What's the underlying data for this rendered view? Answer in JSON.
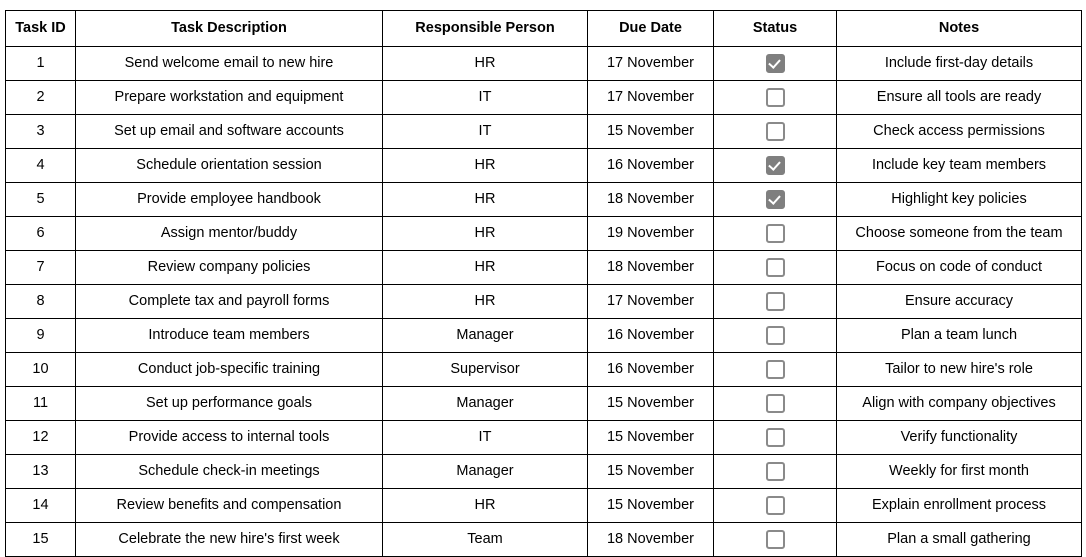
{
  "table": {
    "columns": [
      {
        "key": "task_id",
        "label": "Task ID"
      },
      {
        "key": "task_desc",
        "label": "Task Description"
      },
      {
        "key": "person",
        "label": "Responsible Person"
      },
      {
        "key": "due_date",
        "label": "Due Date"
      },
      {
        "key": "status",
        "label": "Status"
      },
      {
        "key": "notes",
        "label": "Notes"
      }
    ],
    "colors": {
      "border": "#000000",
      "checkbox_checked_fill": "#7f7f7f",
      "checkbox_unchecked_border": "#8a8a8a",
      "text": "#000000",
      "background": "#ffffff"
    },
    "rows": [
      {
        "task_id": "1",
        "task_desc": "Send welcome email to new hire",
        "person": "HR",
        "due_date": "17 November",
        "status": true,
        "notes": "Include first-day details"
      },
      {
        "task_id": "2",
        "task_desc": "Prepare workstation and equipment",
        "person": "IT",
        "due_date": "17 November",
        "status": false,
        "notes": "Ensure all tools are ready"
      },
      {
        "task_id": "3",
        "task_desc": "Set up email and software accounts",
        "person": "IT",
        "due_date": "15 November",
        "status": false,
        "notes": "Check access permissions"
      },
      {
        "task_id": "4",
        "task_desc": "Schedule orientation session",
        "person": "HR",
        "due_date": "16 November",
        "status": true,
        "notes": "Include key team members"
      },
      {
        "task_id": "5",
        "task_desc": "Provide employee handbook",
        "person": "HR",
        "due_date": "18 November",
        "status": true,
        "notes": "Highlight key policies"
      },
      {
        "task_id": "6",
        "task_desc": "Assign mentor/buddy",
        "person": "HR",
        "due_date": "19 November",
        "status": false,
        "notes": "Choose someone from the team"
      },
      {
        "task_id": "7",
        "task_desc": "Review company policies",
        "person": "HR",
        "due_date": "18 November",
        "status": false,
        "notes": "Focus on code of conduct"
      },
      {
        "task_id": "8",
        "task_desc": "Complete tax and payroll forms",
        "person": "HR",
        "due_date": "17 November",
        "status": false,
        "notes": "Ensure accuracy"
      },
      {
        "task_id": "9",
        "task_desc": "Introduce team members",
        "person": "Manager",
        "due_date": "16 November",
        "status": false,
        "notes": "Plan a team lunch"
      },
      {
        "task_id": "10",
        "task_desc": "Conduct job-specific training",
        "person": "Supervisor",
        "due_date": "16 November",
        "status": false,
        "notes": "Tailor to new hire's role"
      },
      {
        "task_id": "11",
        "task_desc": "Set up performance goals",
        "person": "Manager",
        "due_date": "15 November",
        "status": false,
        "notes": "Align with company objectives"
      },
      {
        "task_id": "12",
        "task_desc": "Provide access to internal tools",
        "person": "IT",
        "due_date": "15 November",
        "status": false,
        "notes": "Verify functionality"
      },
      {
        "task_id": "13",
        "task_desc": "Schedule check-in meetings",
        "person": "Manager",
        "due_date": "15 November",
        "status": false,
        "notes": "Weekly for first month"
      },
      {
        "task_id": "14",
        "task_desc": "Review benefits and compensation",
        "person": "HR",
        "due_date": "15 November",
        "status": false,
        "notes": "Explain enrollment process"
      },
      {
        "task_id": "15",
        "task_desc": "Celebrate the new hire's first week",
        "person": "Team",
        "due_date": "18 November",
        "status": false,
        "notes": "Plan a small gathering"
      }
    ]
  }
}
